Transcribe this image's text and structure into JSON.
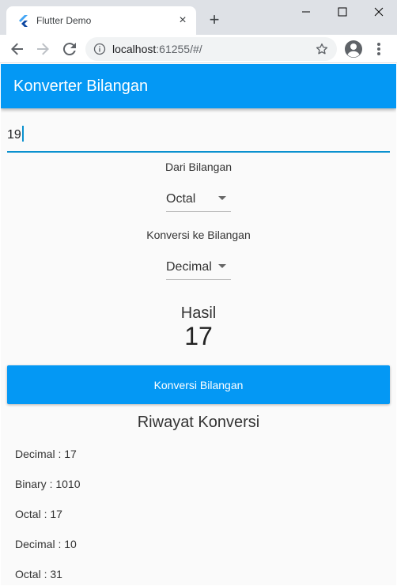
{
  "browser": {
    "tab_title": "Flutter Demo",
    "tab_close": "×",
    "new_tab": "+",
    "url_host": "localhost",
    "url_rest": ":61255/#/"
  },
  "app": {
    "title": "Konverter Bilangan",
    "input_value": "19",
    "from_label": "Dari Bilangan",
    "from_value": "Octal",
    "to_label": "Konversi ke Bilangan",
    "to_value": "Decimal",
    "result_label": "Hasil",
    "result_value": "17",
    "convert_button": "Konversi Bilangan",
    "history_title": "Riwayat Konversi",
    "history": [
      "Decimal : 17",
      "Binary : 1010",
      "Octal : 17",
      "Decimal : 10",
      "Octal : 31"
    ]
  },
  "colors": {
    "accent": "#0498f4",
    "input_underline": "#0a91cf"
  },
  "icons": [
    "flutter-icon",
    "close-icon",
    "plus-icon",
    "minimize-icon",
    "maximize-icon",
    "window-close-icon",
    "back-arrow-icon",
    "forward-arrow-icon",
    "reload-icon",
    "info-icon",
    "star-icon",
    "profile-icon",
    "menu-dots-icon",
    "dropdown-arrow-icon"
  ]
}
